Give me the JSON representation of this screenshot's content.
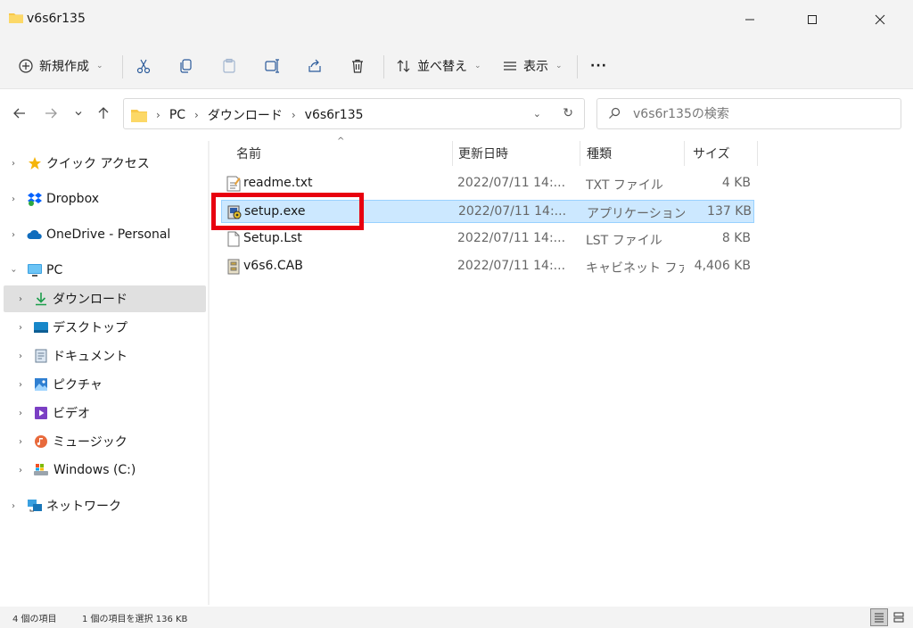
{
  "window": {
    "title": "v6s6r135"
  },
  "toolbar": {
    "new_label": "新規作成",
    "sort_label": "並べ替え",
    "view_label": "表示",
    "more_label": "···"
  },
  "nav": {
    "breadcrumbs": [
      "PC",
      "ダウンロード",
      "v6s6r135"
    ],
    "search_placeholder": "v6s6r135の検索"
  },
  "sidebar": {
    "items": [
      {
        "label": "クイック アクセス",
        "icon": "star-icon"
      },
      {
        "label": "Dropbox",
        "icon": "dropbox-icon"
      },
      {
        "label": "OneDrive - Personal",
        "icon": "cloud-icon"
      },
      {
        "label": "PC",
        "icon": "monitor-icon"
      },
      {
        "label": "ダウンロード",
        "icon": "download-icon"
      },
      {
        "label": "デスクトップ",
        "icon": "desktop-icon"
      },
      {
        "label": "ドキュメント",
        "icon": "document-icon"
      },
      {
        "label": "ピクチャ",
        "icon": "picture-icon"
      },
      {
        "label": "ビデオ",
        "icon": "video-icon"
      },
      {
        "label": "ミュージック",
        "icon": "music-icon"
      },
      {
        "label": "Windows (C:)",
        "icon": "drive-icon"
      },
      {
        "label": "ネットワーク",
        "icon": "network-icon"
      }
    ]
  },
  "columns": {
    "name": "名前",
    "date": "更新日時",
    "type": "種類",
    "size": "サイズ"
  },
  "files": [
    {
      "name": "readme.txt",
      "date": "2022/07/11 14:...",
      "type": "TXT ファイル",
      "size": "4 KB",
      "icon": "text-file-icon"
    },
    {
      "name": "setup.exe",
      "date": "2022/07/11 14:...",
      "type": "アプリケーション",
      "size": "137 KB",
      "icon": "setup-exe-icon"
    },
    {
      "name": "Setup.Lst",
      "date": "2022/07/11 14:...",
      "type": "LST ファイル",
      "size": "8 KB",
      "icon": "blank-file-icon"
    },
    {
      "name": "v6s6.CAB",
      "date": "2022/07/11 14:...",
      "type": "キャビネット ファ...",
      "size": "4,406 KB",
      "icon": "cabinet-file-icon"
    }
  ],
  "status": {
    "count": "4 個の項目",
    "selected": "1 個の項目を選択  136 KB"
  },
  "colors": {
    "selection": "#cce8ff",
    "highlight": "#e8000f",
    "folder": "#f8c84a"
  }
}
